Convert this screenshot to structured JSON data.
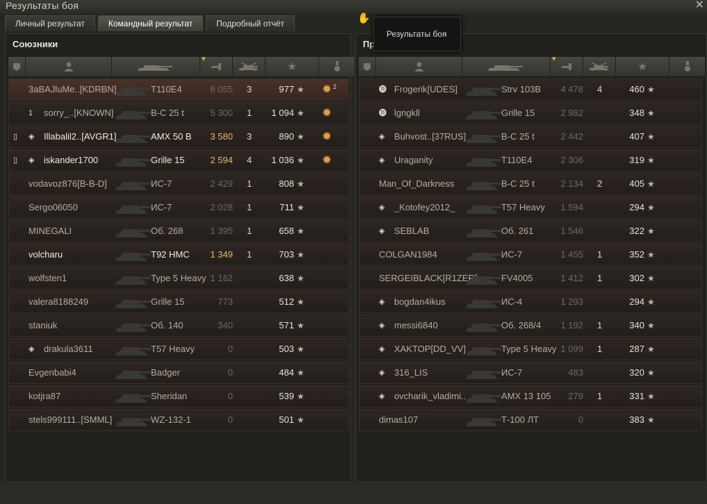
{
  "window": {
    "title": "Результаты боя",
    "close_label": "✕",
    "cursor_label": "✋"
  },
  "tabs": [
    {
      "label": "Личный результат"
    },
    {
      "label": "Командный результат"
    },
    {
      "label": "Подробный отчёт"
    }
  ],
  "tooltip": {
    "text": "Результаты боя"
  },
  "columns": [
    "player",
    "vehicle",
    "damage",
    "kills",
    "experience",
    "medals"
  ],
  "allies": {
    "title": "Союзники",
    "rows": [
      {
        "name": "3aBAJluMe..[KDRBN]",
        "vehicle": "T110E4",
        "damage": "8 055",
        "kills": "3",
        "xp": "977",
        "marks": [
          "",
          ""
        ],
        "medal": "✹",
        "medal_count": "2",
        "self": true
      },
      {
        "name": "sorry_..[KNOWN]",
        "vehicle": "В-С 25 t",
        "damage": "5 300",
        "kills": "1",
        "xp": "1 094",
        "marks": [
          "",
          "1"
        ],
        "medal": "✹",
        "medal_count": ""
      },
      {
        "name": "Illabalil2..[AVGR1]",
        "vehicle": "AMX 50 B",
        "damage": "3 580",
        "kills": "3",
        "xp": "890",
        "marks": [
          "▯",
          "◈"
        ],
        "medal": "✹",
        "medal_count": "",
        "highlight": true
      },
      {
        "name": "iskander1700",
        "vehicle": "Grille 15",
        "damage": "2 594",
        "kills": "4",
        "xp": "1 036",
        "marks": [
          "▯",
          "◈"
        ],
        "medal": "✹",
        "medal_count": "",
        "highlight": true
      },
      {
        "name": "vodavoz876[B-B-D]",
        "vehicle": "ИС-7",
        "damage": "2 429",
        "kills": "1",
        "xp": "808",
        "marks": [
          "",
          ""
        ],
        "medal": "",
        "medal_count": ""
      },
      {
        "name": "Sergo06050",
        "vehicle": "ИС-7",
        "damage": "2 028",
        "kills": "1",
        "xp": "711",
        "marks": [
          "",
          ""
        ],
        "medal": "",
        "medal_count": ""
      },
      {
        "name": "MINEGALI",
        "vehicle": "Об. 268",
        "damage": "1 395",
        "kills": "1",
        "xp": "658",
        "marks": [
          "",
          ""
        ],
        "medal": "",
        "medal_count": ""
      },
      {
        "name": "volcharu",
        "vehicle": "T92 HMC",
        "damage": "1 349",
        "kills": "1",
        "xp": "703",
        "marks": [
          "",
          ""
        ],
        "medal": "",
        "medal_count": "",
        "highlight": true
      },
      {
        "name": "wolfsten1",
        "vehicle": "Type 5 Heavy",
        "damage": "1 162",
        "kills": "",
        "xp": "638",
        "marks": [
          "",
          ""
        ],
        "medal": "",
        "medal_count": ""
      },
      {
        "name": "valera8188249",
        "vehicle": "Grille 15",
        "damage": "773",
        "kills": "",
        "xp": "512",
        "marks": [
          "",
          ""
        ],
        "medal": "",
        "medal_count": ""
      },
      {
        "name": "staniuk",
        "vehicle": "Об. 140",
        "damage": "340",
        "kills": "",
        "xp": "571",
        "marks": [
          "",
          ""
        ],
        "medal": "",
        "medal_count": ""
      },
      {
        "name": "drakula3611",
        "vehicle": "T57 Heavy",
        "damage": "0",
        "kills": "",
        "xp": "503",
        "marks": [
          "",
          "◈"
        ],
        "medal": "",
        "medal_count": ""
      },
      {
        "name": "Evgenbabi4",
        "vehicle": "Badger",
        "damage": "0",
        "kills": "",
        "xp": "484",
        "marks": [
          "",
          ""
        ],
        "medal": "",
        "medal_count": ""
      },
      {
        "name": "kotjra87",
        "vehicle": "Sheridan",
        "damage": "0",
        "kills": "",
        "xp": "539",
        "marks": [
          "",
          ""
        ],
        "medal": "",
        "medal_count": ""
      },
      {
        "name": "stels999111..[SMML]",
        "vehicle": "WZ-132-1",
        "damage": "0",
        "kills": "",
        "xp": "501",
        "marks": [
          "",
          ""
        ],
        "medal": "",
        "medal_count": ""
      }
    ]
  },
  "enemies": {
    "title": "Пр",
    "rows": [
      {
        "name": "Frogerik[UDES]",
        "vehicle": "Strv 103B",
        "damage": "4 478",
        "kills": "4",
        "xp": "460",
        "marks": [
          "",
          "⓫"
        ]
      },
      {
        "name": "lgngkll",
        "vehicle": "Grille 15",
        "damage": "2 982",
        "kills": "",
        "xp": "348",
        "marks": [
          "",
          "⓫"
        ]
      },
      {
        "name": "Buhvost..[37RUS]",
        "vehicle": "В-С 25 t",
        "damage": "2 442",
        "kills": "",
        "xp": "407",
        "marks": [
          "",
          "◈"
        ]
      },
      {
        "name": "Uraganity",
        "vehicle": "T110E4",
        "damage": "2 306",
        "kills": "",
        "xp": "319",
        "marks": [
          "",
          "◈"
        ]
      },
      {
        "name": "Man_Of_Darkness",
        "vehicle": "В-С 25 t",
        "damage": "2 134",
        "kills": "2",
        "xp": "405",
        "marks": [
          "",
          ""
        ]
      },
      {
        "name": "_Kotofey2012_",
        "vehicle": "T57 Heavy",
        "damage": "1 594",
        "kills": "",
        "xp": "294",
        "marks": [
          "",
          "◈"
        ]
      },
      {
        "name": "SEBLAB",
        "vehicle": "Об. 261",
        "damage": "1 546",
        "kills": "",
        "xp": "322",
        "marks": [
          "",
          "◈"
        ]
      },
      {
        "name": "COLGAN1984",
        "vehicle": "ИС-7",
        "damage": "1 455",
        "kills": "1",
        "xp": "352",
        "marks": [
          "",
          ""
        ]
      },
      {
        "name": "SERGEIBLACK[R1ZER]",
        "vehicle": "FV4005",
        "damage": "1 412",
        "kills": "1",
        "xp": "302",
        "marks": [
          "",
          ""
        ]
      },
      {
        "name": "bogdan4ikus",
        "vehicle": "ИС-4",
        "damage": "1 293",
        "kills": "",
        "xp": "294",
        "marks": [
          "",
          "◈"
        ]
      },
      {
        "name": "messi6840",
        "vehicle": "Об. 268/4",
        "damage": "1 192",
        "kills": "1",
        "xp": "340",
        "marks": [
          "",
          "◈"
        ]
      },
      {
        "name": "XAKTOP[DD_VV]",
        "vehicle": "Type 5 Heavy",
        "damage": "1 099",
        "kills": "1",
        "xp": "287",
        "marks": [
          "",
          "◈"
        ]
      },
      {
        "name": "316_LIS",
        "vehicle": "ИС-7",
        "damage": "483",
        "kills": "",
        "xp": "320",
        "marks": [
          "",
          "◈"
        ]
      },
      {
        "name": "ovcharik_vladimi..",
        "vehicle": "AMX 13 105",
        "damage": "279",
        "kills": "1",
        "xp": "331",
        "marks": [
          "",
          "◈"
        ]
      },
      {
        "name": "dimas107",
        "vehicle": "Т-100 ЛТ",
        "damage": "0",
        "kills": "",
        "xp": "383",
        "marks": [
          "",
          ""
        ]
      }
    ]
  },
  "icons": {
    "star": "★",
    "platoon": "platoon-icon",
    "player": "player-icon",
    "vehicle": "vehicle-icon",
    "damage": "damage-icon",
    "kills": "kills-icon",
    "xp": "star-icon",
    "medal": "medal-icon",
    "sort": "▾"
  },
  "colors": {
    "damage_gold": "#e8b86a",
    "self_row": "#4a3028",
    "medal": "#e0a040"
  }
}
